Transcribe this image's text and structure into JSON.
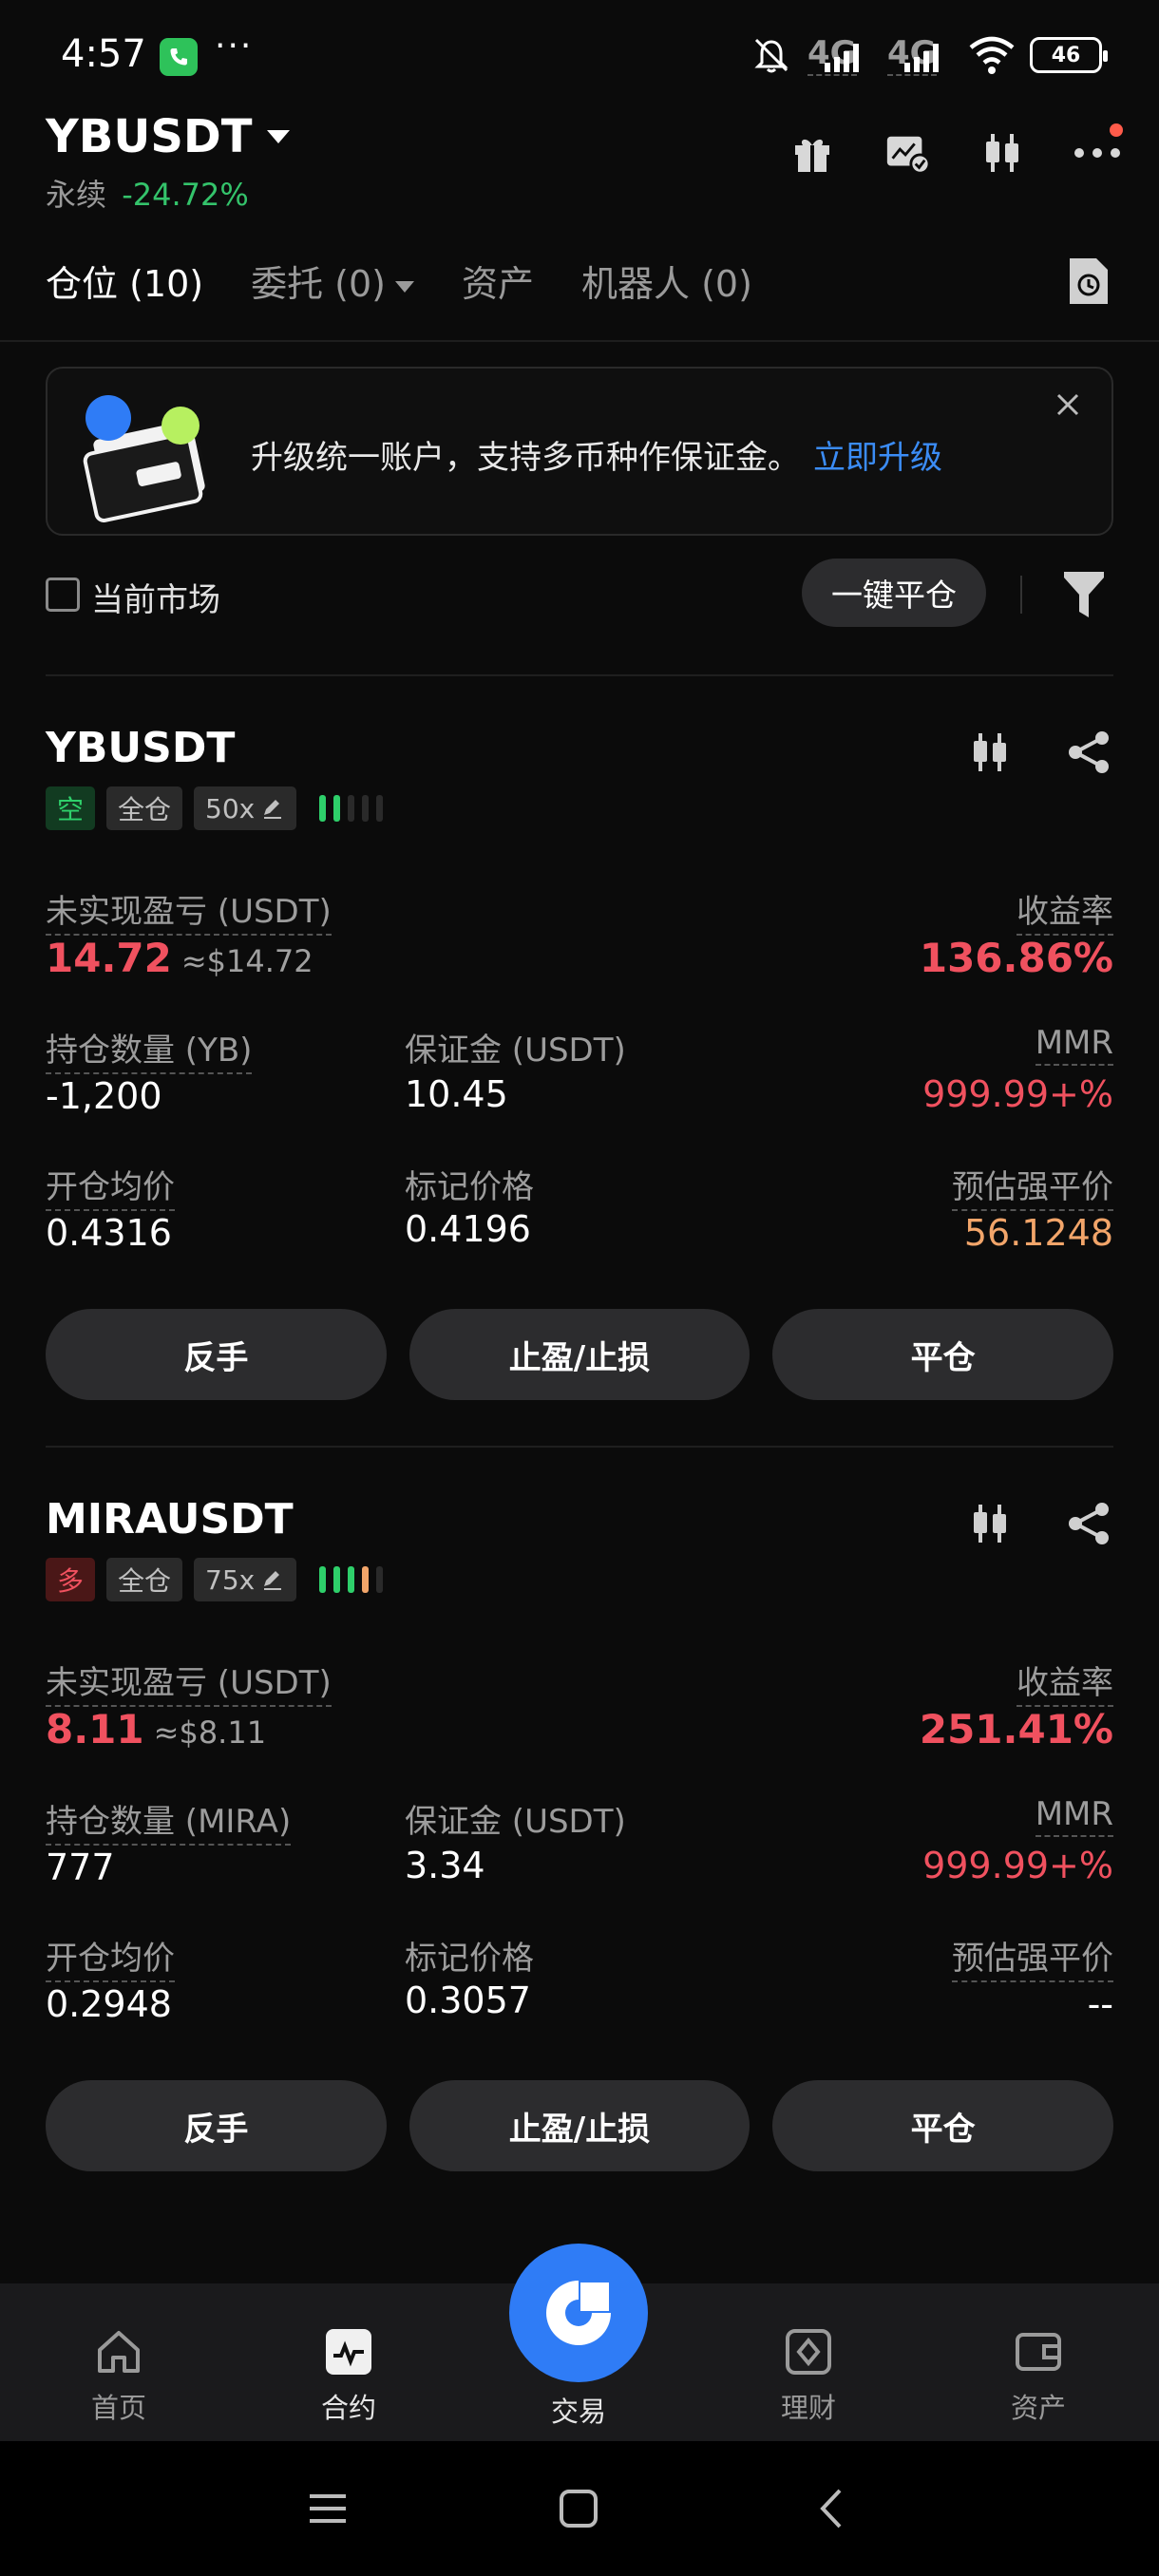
{
  "status_bar": {
    "time": "4:57",
    "dots": "···",
    "network1": "4G",
    "network2": "4G",
    "battery": "46"
  },
  "header": {
    "symbol": "YBUSDT",
    "contract_type": "永续",
    "change": "-24.72%",
    "icons": [
      "gift-icon",
      "chart-check-icon",
      "candlestick-icon",
      "more-icon"
    ]
  },
  "tabs": [
    {
      "label": "仓位 (10)",
      "active": true
    },
    {
      "label": "委托 (0)",
      "active": false,
      "has_dropdown": true
    },
    {
      "label": "资产",
      "active": false
    },
    {
      "label": "机器人 (0)",
      "active": false
    }
  ],
  "banner": {
    "text": "升级统一账户，支持多币种作保证金。",
    "link": "立即升级"
  },
  "filter_row": {
    "checkbox_label": "当前市场",
    "close_all": "一键平仓"
  },
  "positions": [
    {
      "symbol": "YBUSDT",
      "side": "空",
      "side_type": "short",
      "margin_mode": "全仓",
      "leverage": "50x",
      "risk_level": 2,
      "pnl_label": "未实现盈亏 (USDT)",
      "pnl": "14.72",
      "pnl_usd": "≈$14.72",
      "roe_label": "收益率",
      "roe": "136.86%",
      "qty_label": "持仓数量 (YB)",
      "qty": "-1,200",
      "margin_label": "保证金 (USDT)",
      "margin": "10.45",
      "mmr_label": "MMR",
      "mmr": "999.99+%",
      "entry_label": "开仓均价",
      "entry": "0.4316",
      "mark_label": "标记价格",
      "mark": "0.4196",
      "liq_label": "预估强平价",
      "liq": "56.1248",
      "btn_reverse": "反手",
      "btn_tpsl": "止盈/止损",
      "btn_close": "平仓"
    },
    {
      "symbol": "MIRAUSDT",
      "side": "多",
      "side_type": "long",
      "margin_mode": "全仓",
      "leverage": "75x",
      "risk_level": 4,
      "pnl_label": "未实现盈亏 (USDT)",
      "pnl": "8.11",
      "pnl_usd": "≈$8.11",
      "roe_label": "收益率",
      "roe": "251.41%",
      "qty_label": "持仓数量 (MIRA)",
      "qty": "777",
      "margin_label": "保证金 (USDT)",
      "margin": "3.34",
      "mmr_label": "MMR",
      "mmr": "999.99+%",
      "entry_label": "开仓均价",
      "entry": "0.2948",
      "mark_label": "标记价格",
      "mark": "0.3057",
      "liq_label": "预估强平价",
      "liq": "--",
      "btn_reverse": "反手",
      "btn_tpsl": "止盈/止损",
      "btn_close": "平仓"
    }
  ],
  "bottom_nav": [
    {
      "label": "首页",
      "icon": "home-icon"
    },
    {
      "label": "合约",
      "icon": "futures-icon",
      "active": true
    },
    {
      "label": "交易",
      "icon": "trade-fab-icon"
    },
    {
      "label": "理财",
      "icon": "earn-icon"
    },
    {
      "label": "资产",
      "icon": "wallet-icon"
    }
  ],
  "colors": {
    "accent_blue": "#2f7cf6",
    "profit_red": "#f0515f",
    "green": "#34c36b",
    "liq_orange": "#f2a56a"
  }
}
